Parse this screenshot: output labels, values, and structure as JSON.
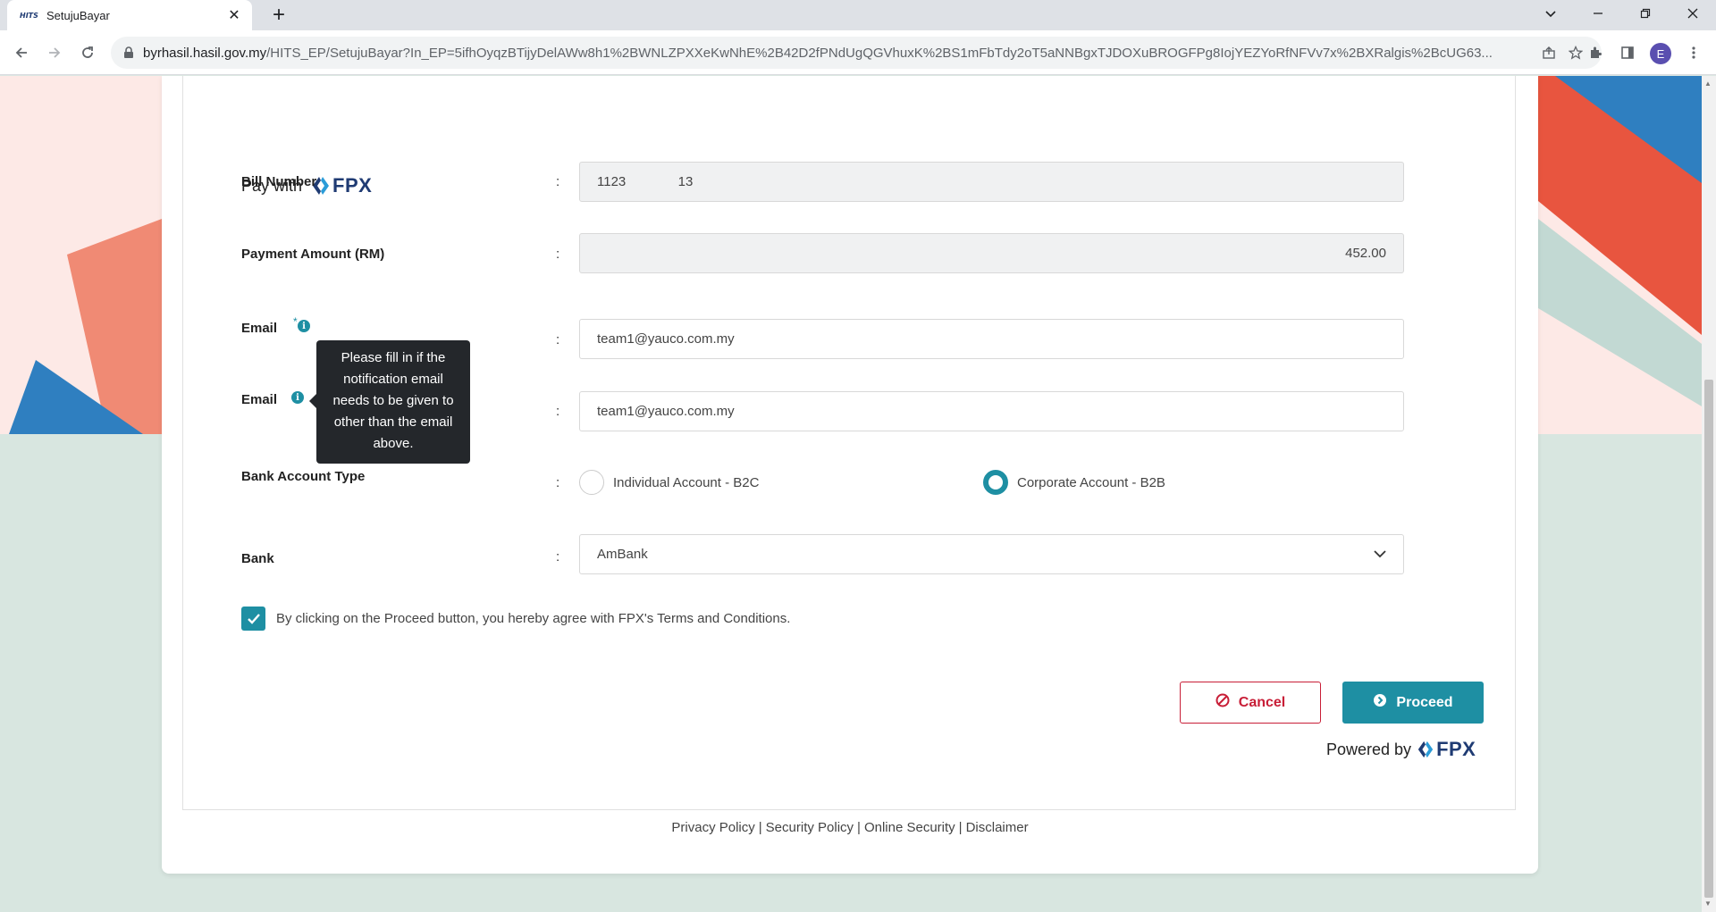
{
  "browser": {
    "tab_title": "SetujuBayar",
    "tab_favicon": "HITS",
    "url_host": "byrhasil.hasil.gov.my",
    "url_path": "/HITS_EP/SetujuBayar?In_EP=5ifhOyqzBTijyDelAWw8h1%2BWNLZPXXeKwNhE%2B42D2fPNdUgQGVhuxK%2BS1mFbTdy2oT5aNNBgxTJDOXuBROGFPg8IojYEZYoRfNFVv7x%2BXRalgis%2BcUG63...",
    "profile_initial": "E",
    "icons": [
      "back-icon",
      "forward-icon",
      "reload-icon",
      "lock-icon",
      "share-icon",
      "star-icon",
      "extensions-icon",
      "sidepanel-icon",
      "menu-icon"
    ]
  },
  "page": {
    "pay_with_label": "Pay with",
    "fpx_text": "FPX",
    "bill_number_label": "Bill Number",
    "bill_number_value": "1123              13",
    "payment_amount_label": "Payment Amount (RM)",
    "payment_amount_value": "452.00",
    "email_label": "Email",
    "email_required_mark": "*",
    "email_value": "team1@yauco.com.my",
    "email2_label": "Email",
    "email2_value": "team1@yauco.com.my",
    "tooltip_text": "Please fill in if the notification email needs to be given to other than the email above.",
    "colon": ":",
    "bank_account_type_label": "Bank Account Type",
    "account_options": [
      "Individual Account - B2C",
      "Corporate Account - B2B"
    ],
    "selected_account": "Corporate Account - B2B",
    "bank_label": "Bank",
    "bank_selected": "AmBank",
    "agree_text": "By clicking on the Proceed button, you hereby agree with FPX's Terms and Conditions.",
    "agree_checked": true,
    "cancel_label": "Cancel",
    "proceed_label": "Proceed",
    "powered_by_label": "Powered by",
    "footer_links": [
      "Privacy Policy",
      "Security Policy",
      "Online Security",
      "Disclaimer"
    ]
  },
  "colors": {
    "accent": "#1e8fa3",
    "cancel": "#c81e37",
    "fpx_blue": "#1f3b73",
    "bg_pink": "#fde9e6",
    "bg_teal": "#d8e6e0"
  }
}
